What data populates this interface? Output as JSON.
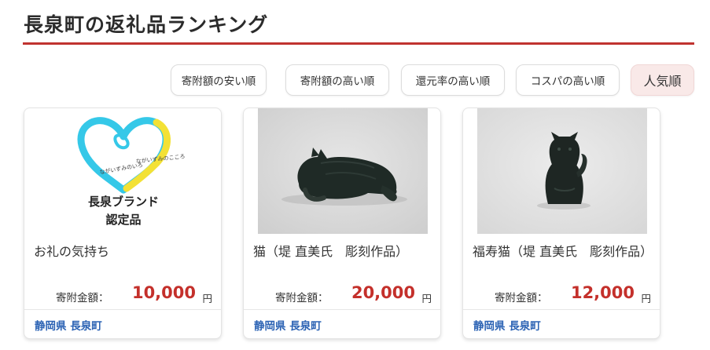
{
  "page": {
    "title": "長泉町の返礼品ランキング"
  },
  "sort_options": [
    {
      "label": "寄附額の安い順",
      "active": false
    },
    {
      "label": "寄附額の高い順",
      "active": false
    },
    {
      "label": "還元率の高い順",
      "active": false
    },
    {
      "label": "コスパの高い順",
      "active": false
    },
    {
      "label": "人気順",
      "active": true
    }
  ],
  "colors": {
    "accent": "#c0332f",
    "price": "#c4302b",
    "location": "#2c63b4",
    "active_sort_bg": "#f9e9e8",
    "logo_cyan": "#35c8e8",
    "logo_yellow": "#f3e135"
  },
  "products": [
    {
      "name": "お礼の気持ち",
      "price_label": "寄附金額：",
      "price": "10,000",
      "unit": "円",
      "location": "静岡県 長泉町",
      "image_icon": "nagaizumi-brand-logo",
      "logo_text": {
        "script_left": "ながいずみのいろ",
        "script_right": "ながいずみのこころ",
        "line1": "長泉ブランド",
        "line2": "認定品"
      }
    },
    {
      "name": "猫（堤 直美氏　彫刻作品）",
      "price_label": "寄附金額：",
      "price": "20,000",
      "unit": "円",
      "location": "静岡県 長泉町",
      "image_icon": "lying-cat-sculpture"
    },
    {
      "name": "福寿猫（堤 直美氏　彫刻作品）",
      "price_label": "寄附金額：",
      "price": "12,000",
      "unit": "円",
      "location": "静岡県 長泉町",
      "image_icon": "beckoning-cat-sculpture"
    }
  ]
}
